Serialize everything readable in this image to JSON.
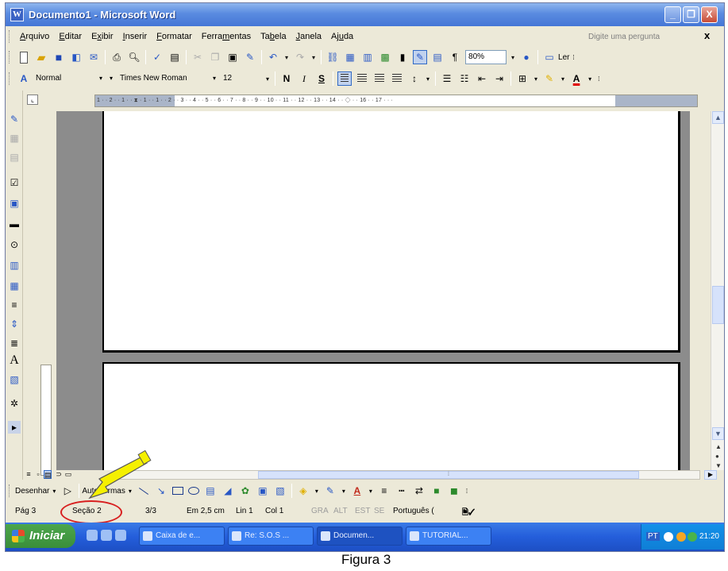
{
  "window": {
    "title": "Documento1 - Microsoft Word",
    "controls": [
      "_",
      "❐",
      "X"
    ]
  },
  "menu": {
    "items": [
      {
        "pre": "",
        "u": "A",
        "post": "rquivo"
      },
      {
        "pre": "",
        "u": "E",
        "post": "ditar"
      },
      {
        "pre": "E",
        "u": "x",
        "post": "ibir"
      },
      {
        "pre": "",
        "u": "I",
        "post": "nserir"
      },
      {
        "pre": "",
        "u": "F",
        "post": "ormatar"
      },
      {
        "pre": "Ferra",
        "u": "m",
        "post": "entas"
      },
      {
        "pre": "Ta",
        "u": "b",
        "post": "ela"
      },
      {
        "pre": "",
        "u": "J",
        "post": "anela"
      },
      {
        "pre": "Aj",
        "u": "u",
        "post": "da"
      }
    ],
    "help_placeholder": "Digite uma pergunta",
    "close_glyph": "x"
  },
  "standard_toolbar": {
    "zoom": "80%",
    "read_label": "Ler"
  },
  "formatting_toolbar": {
    "style": "Normal",
    "font": "Times New Roman",
    "size": "12",
    "bold": "N",
    "italic": "I",
    "underline": "S",
    "font_color_letter": "A"
  },
  "ruler": {
    "ticks": "1 · · 2 · · 1 · · ⧗ · 1 · · 1 · · 2 · · 3 · · 4 · · 5 · · 6 · · 7 · · 8 · · 9 · · 10 · · 11 · · 12 · · 13 · · 14 · · ◇ · · 16 · · 17 · · ·"
  },
  "drawing_toolbar": {
    "draw_label": "Desenhar",
    "autoshapes_label": "AutoFormas"
  },
  "status": {
    "page": "Pág 3",
    "section": "Seção 2",
    "pages": "3/3",
    "position": "Em 2,5 cm",
    "line": "Lin 1",
    "col": "Col 1",
    "rec": "GRA",
    "trk": "ALT",
    "ext": "EST",
    "ovr": "SE",
    "language": "Português (",
    "highlight_color": "#d82020"
  },
  "taskbar": {
    "start_label": "Iniciar",
    "tasks": [
      {
        "label": "Caixa de e...",
        "active": false
      },
      {
        "label": "Re: S.O.S ...",
        "active": false
      },
      {
        "label": "Documen...",
        "active": true
      },
      {
        "label": "TUTORIAL...",
        "active": false
      }
    ],
    "tray_lang": "PT",
    "clock": "21:20"
  },
  "caption": "Figura 3",
  "colors": {
    "title_bar": "#4476d6",
    "taskbar": "#245edb",
    "start_button": "#3a8e3a",
    "arrow_fill": "#f5f000"
  }
}
